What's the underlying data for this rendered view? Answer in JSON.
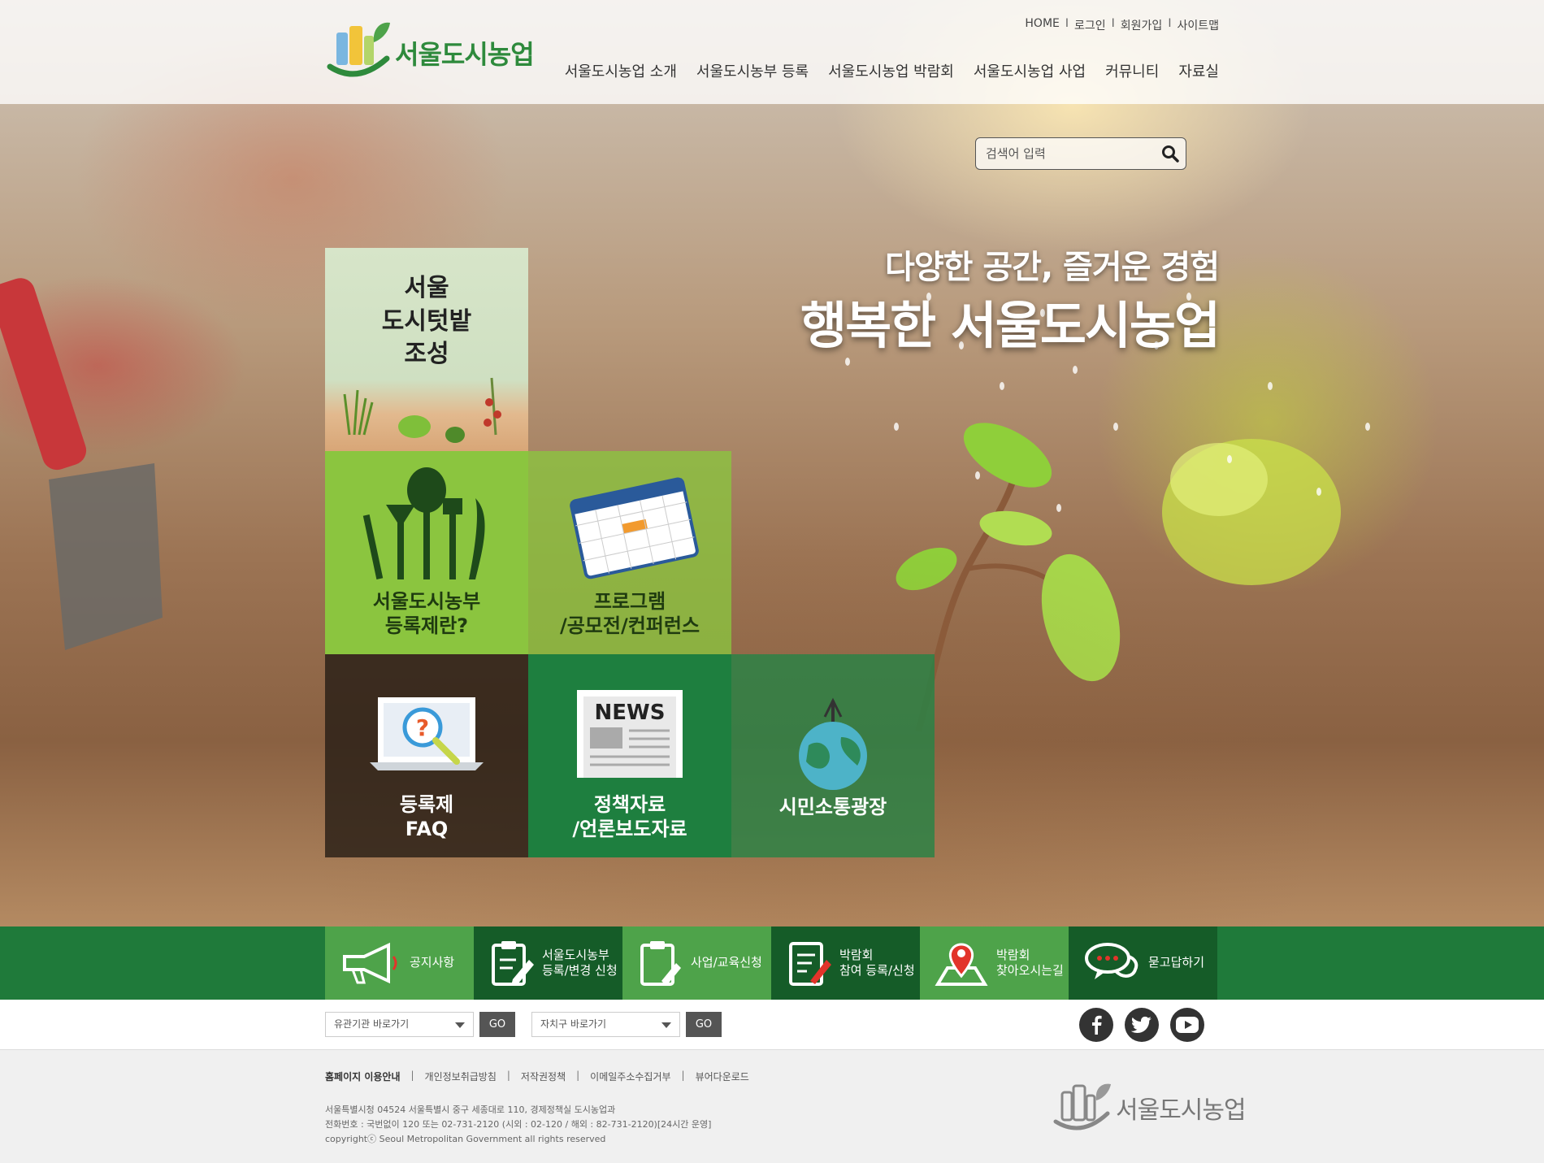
{
  "header": {
    "logo_text": "서울도시농업",
    "util": [
      "HOME",
      "로그인",
      "회원가입",
      "사이트맵"
    ],
    "gnb": [
      "서울도시농업 소개",
      "서울도시농부 등록",
      "서울도시농업 박람회",
      "서울도시농업 사업",
      "커뮤니티",
      "자료실"
    ]
  },
  "search": {
    "placeholder": "검색어 입력"
  },
  "slogan": {
    "line1": "다양한 공간, 즐거운 경험",
    "line2": "행복한 서울도시농업"
  },
  "tiles": {
    "farm": "서울\n도시텃밭\n조성",
    "register": "서울도시농부\n등록제란?",
    "program": "프로그램\n/공모전/컨퍼런스",
    "faq": "등록제\nFAQ",
    "news_icon": "NEWS",
    "news": "정책자료\n/언론보도자료",
    "citizen": "시민소통광장"
  },
  "quick": [
    {
      "label": "공지사항",
      "icon": "megaphone-icon"
    },
    {
      "label": "서울도시농부\n등록/변경 신청",
      "icon": "clipboard-edit-icon"
    },
    {
      "label": "사업/교육신청",
      "icon": "clipboard-pen-icon"
    },
    {
      "label": "박람회\n참여 등록/신청",
      "icon": "document-pen-icon"
    },
    {
      "label": "박람회\n찾아오시는길",
      "icon": "map-pin-icon"
    },
    {
      "label": "묻고답하기",
      "icon": "chat-bubbles-icon"
    }
  ],
  "selects": {
    "agency": "유관기관 바로가기",
    "district": "자치구 바로가기",
    "go": "GO"
  },
  "sns": [
    "facebook-icon",
    "twitter-icon",
    "youtube-icon"
  ],
  "footer": {
    "links": [
      "홈페이지 이용안내",
      "개인정보취급방침",
      "저작권정책",
      "이메일주소수집거부",
      "뷰어다운로드"
    ],
    "address": "서울특별시청 04524 서울특별시 중구 세종대로 110, 경제정책실 도시농업과",
    "phone": "전화번호 : 국번없이 120 또는 02-731-2120 (시외 : 02-120 / 해외 : 82-731-2120)[24시간 운영]",
    "copyright": "copyrightⓒ Seoul Metropolitan Government all rights reserved",
    "logo_text": "서울도시농업"
  },
  "colors": {
    "brand_green": "#2e8a3c",
    "lime": "#8bc53f",
    "dark_green": "#155c28"
  }
}
